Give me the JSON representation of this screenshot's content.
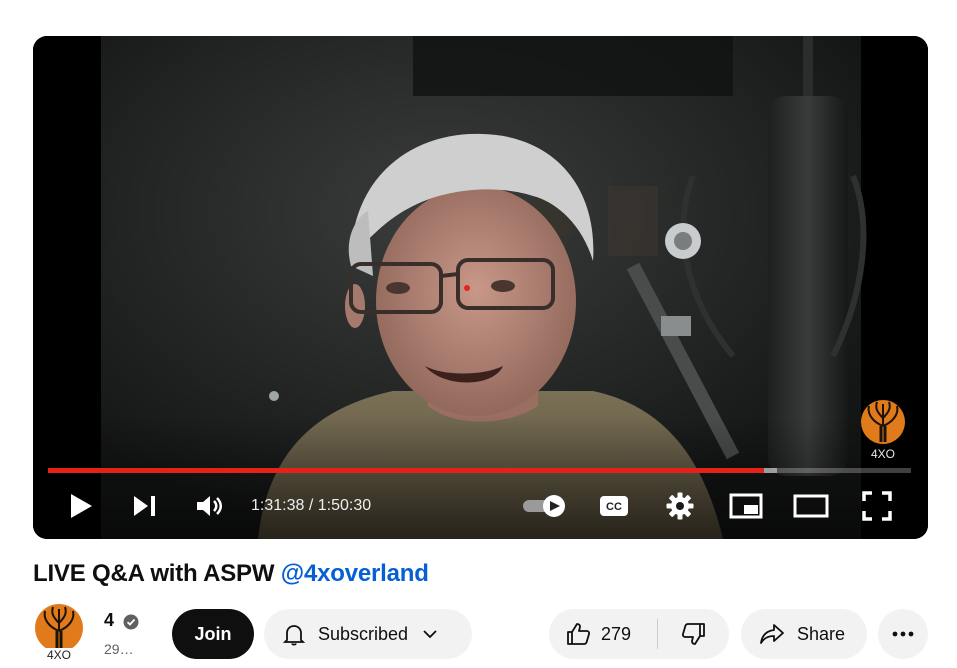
{
  "player": {
    "time_current": "1:31:38",
    "time_total": "1:50:30",
    "time_display": "1:31:38 / 1:50:30",
    "progress_played": 0.8293,
    "progress_buffered": 0.845,
    "autoplay_on": true,
    "watermark_text": "4XO"
  },
  "video": {
    "title": "LIVE Q&A with ASPW",
    "title_link": "@4xoverland"
  },
  "channel": {
    "name": "4",
    "subscribers": "29…",
    "avatar_text": "4XO",
    "verified_icon": "check-badge-icon"
  },
  "actions": {
    "join_label": "Join",
    "subscribed_label": "Subscribed",
    "like_count": "279",
    "share_label": "Share"
  },
  "colors": {
    "progress_played": "#e62117",
    "title_link": "#065fd4",
    "button_bg": "#f2f2f2",
    "join_bg": "#0f0f0f",
    "logo_orange": "#e07a1a"
  }
}
